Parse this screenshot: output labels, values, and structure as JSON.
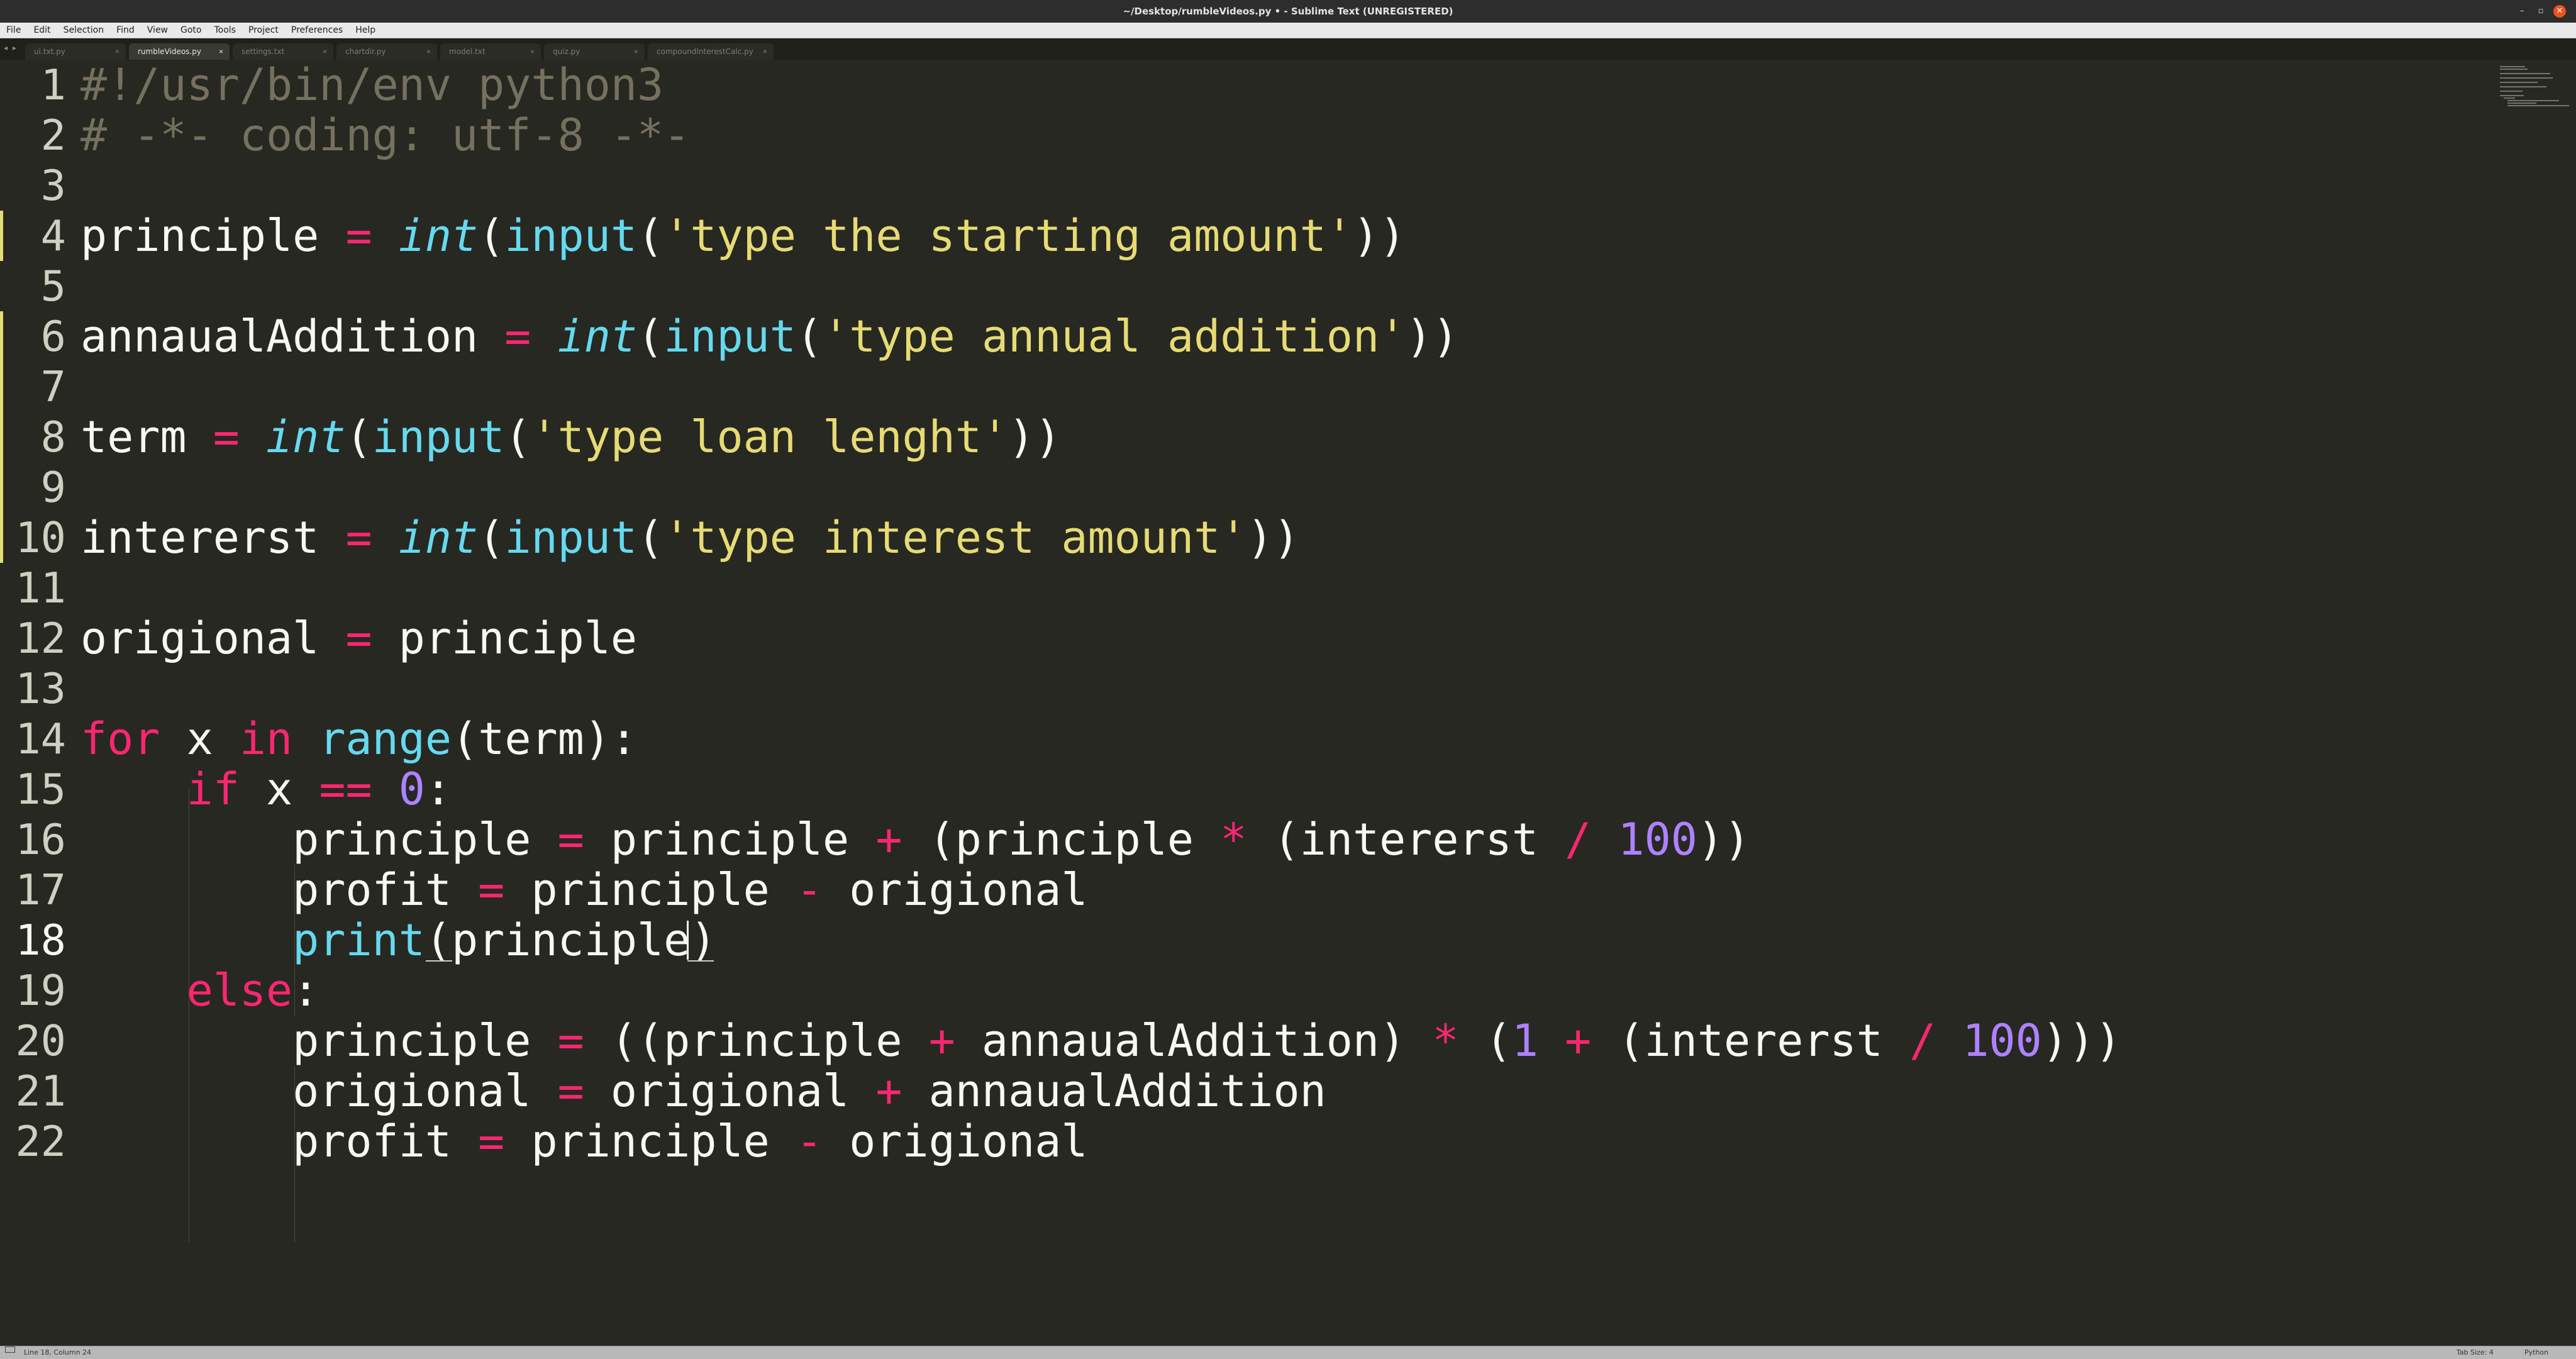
{
  "window": {
    "title": "~/Desktop/rumbleVideos.py • - Sublime Text (UNREGISTERED)",
    "controls": {
      "minimize": "–",
      "maximize": "▫",
      "close": "✕"
    }
  },
  "menu": [
    "File",
    "Edit",
    "Selection",
    "Find",
    "View",
    "Goto",
    "Tools",
    "Project",
    "Preferences",
    "Help"
  ],
  "tabs": {
    "nav": "◂ ▸",
    "items": [
      {
        "label": "ui.txt.py",
        "close": "×"
      },
      {
        "label": "rumbleVideos.py",
        "close": "×",
        "active": true
      },
      {
        "label": "settings.txt",
        "close": "×"
      },
      {
        "label": "chartdir.py",
        "close": "×"
      },
      {
        "label": "model.txt",
        "close": "×"
      },
      {
        "label": "quiz.py",
        "close": "×"
      },
      {
        "label": "compoundInterestCalc.py",
        "close": "×"
      }
    ]
  },
  "editor": {
    "current_line": 18,
    "lines": [
      {
        "n": "1"
      },
      {
        "n": "2"
      },
      {
        "n": "3"
      },
      {
        "n": "4"
      },
      {
        "n": "5"
      },
      {
        "n": "6"
      },
      {
        "n": "7"
      },
      {
        "n": "8"
      },
      {
        "n": "9"
      },
      {
        "n": "10"
      },
      {
        "n": "11"
      },
      {
        "n": "12"
      },
      {
        "n": "13"
      },
      {
        "n": "14"
      },
      {
        "n": "15"
      },
      {
        "n": "16"
      },
      {
        "n": "17"
      },
      {
        "n": "18"
      },
      {
        "n": "19"
      },
      {
        "n": "20"
      },
      {
        "n": "21"
      },
      {
        "n": "22"
      }
    ],
    "code": {
      "l1": {
        "a": "#!/usr/bin/env python3"
      },
      "l2": {
        "a": "# -*- coding: utf-8 -*-"
      },
      "l4": {
        "a": "principle ",
        "b": "=",
        "c": " ",
        "d": "int",
        "e": "(",
        "f": "input",
        "g": "(",
        "h": "'type the starting amount'",
        "i": "))"
      },
      "l6": {
        "a": "annaualAddition ",
        "b": "=",
        "c": " ",
        "d": "int",
        "e": "(",
        "f": "input",
        "g": "(",
        "h": "'type annual addition'",
        "i": "))"
      },
      "l8": {
        "a": "term ",
        "b": "=",
        "c": " ",
        "d": "int",
        "e": "(",
        "f": "input",
        "g": "(",
        "h": "'type loan lenght'",
        "i": "))"
      },
      "l10": {
        "a": "intererst ",
        "b": "=",
        "c": " ",
        "d": "int",
        "e": "(",
        "f": "input",
        "g": "(",
        "h": "'type interest amount'",
        "i": "))"
      },
      "l12": {
        "a": "origional ",
        "b": "=",
        "c": " principle"
      },
      "l14": {
        "a": "for",
        "b": " x ",
        "c": "in",
        "d": " ",
        "e": "range",
        "f": "(term):"
      },
      "l15": {
        "a": "    ",
        "b": "if",
        "c": " x ",
        "d": "==",
        "e": " ",
        "f": "0",
        "g": ":"
      },
      "l16": {
        "a": "        principle ",
        "b": "=",
        "c": " principle ",
        "d": "+",
        "e": " (principle ",
        "f": "*",
        "g": " (intererst ",
        "h": "/",
        "i": " ",
        "j": "100",
        "k": "))"
      },
      "l17": {
        "a": "        profit ",
        "b": "=",
        "c": " principle ",
        "d": "-",
        "e": " origional"
      },
      "l18": {
        "a": "        ",
        "b": "print",
        "c": "(principle)"
      },
      "l19": {
        "a": "    ",
        "b": "else",
        "c": ":"
      },
      "l20": {
        "a": "        principle ",
        "b": "=",
        "c": " ((principle ",
        "d": "+",
        "e": " annaualAddition) ",
        "f": "*",
        "g": " (",
        "h": "1",
        "i": " ",
        "j": "+",
        "k": " (intererst ",
        "l": "/",
        "m": " ",
        "n": "100",
        "o": ")))"
      },
      "l21": {
        "a": "        origional ",
        "b": "=",
        "c": " origional ",
        "d": "+",
        "e": " annaualAddition"
      },
      "l22": {
        "a": "        profit ",
        "b": "=",
        "c": " principle ",
        "d": "-",
        "e": " origional"
      }
    }
  },
  "statusbar": {
    "position": "Line 18, Column 24",
    "tab_size": "Tab Size: 4",
    "syntax": "Python"
  }
}
